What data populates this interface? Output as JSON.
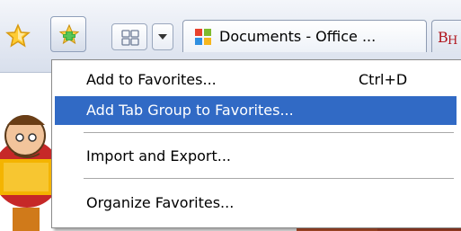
{
  "toolbar": {
    "icons": [
      "favorites-star-icon",
      "star-plus-icon",
      "quick-tabs-icon",
      "chevron-down-icon"
    ]
  },
  "tabs": [
    {
      "title": "Documents - Office ...",
      "icon": "office-logo-icon",
      "active": true
    },
    {
      "title": "",
      "icon": "site-favicon-icon",
      "active": false
    }
  ],
  "menu": {
    "items": [
      {
        "label": "Add to Favorites...",
        "shortcut": "Ctrl+D"
      },
      {
        "label": "Add Tab Group to Favorites...",
        "highlighted": true
      },
      {
        "label": "Import and Export..."
      },
      {
        "label": "Organize Favorites..."
      }
    ],
    "highlight_color": "#316ac5"
  }
}
